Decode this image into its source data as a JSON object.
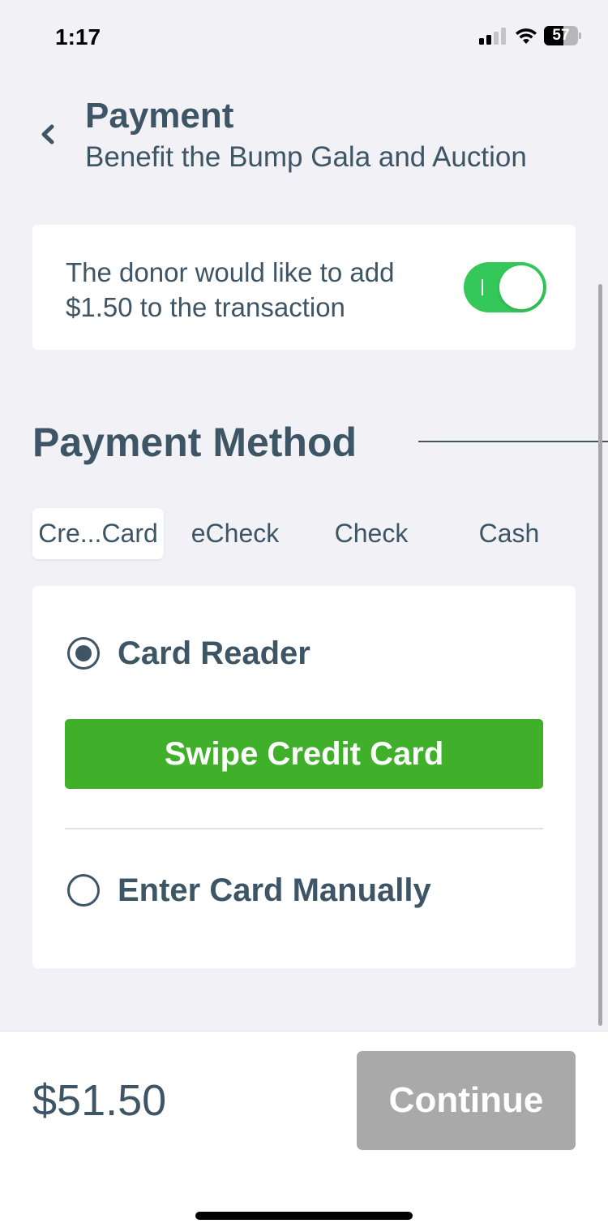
{
  "status_bar": {
    "time": "1:17",
    "battery_level": "57",
    "battery_fraction": 0.57,
    "icons": [
      "signal-icon",
      "wifi-icon",
      "battery-icon"
    ]
  },
  "header": {
    "back_icon": "chevron-left-icon",
    "title": "Payment",
    "subtitle": "Benefit the Bump Gala and Auction"
  },
  "donor_option": {
    "text": "The donor would like to add $1.50 to the transaction",
    "toggle_on": true
  },
  "payment_method": {
    "title": "Payment Method",
    "tabs": [
      {
        "label": "Cre...Card",
        "active": true
      },
      {
        "label": "eCheck",
        "active": false
      },
      {
        "label": "Check",
        "active": false
      },
      {
        "label": "Cash",
        "active": false
      }
    ]
  },
  "card_options": {
    "card_reader_label": "Card Reader",
    "card_reader_selected": true,
    "swipe_button_label": "Swipe Credit Card",
    "manual_label": "Enter Card Manually",
    "manual_selected": false
  },
  "footer": {
    "total": "$51.50",
    "continue_label": "Continue"
  },
  "colors": {
    "accent_text": "#3e5566",
    "toggle_on": "#34c759",
    "swipe_button": "#40b02b",
    "continue_disabled": "#a9a9a9",
    "background": "#f1f1f6"
  }
}
